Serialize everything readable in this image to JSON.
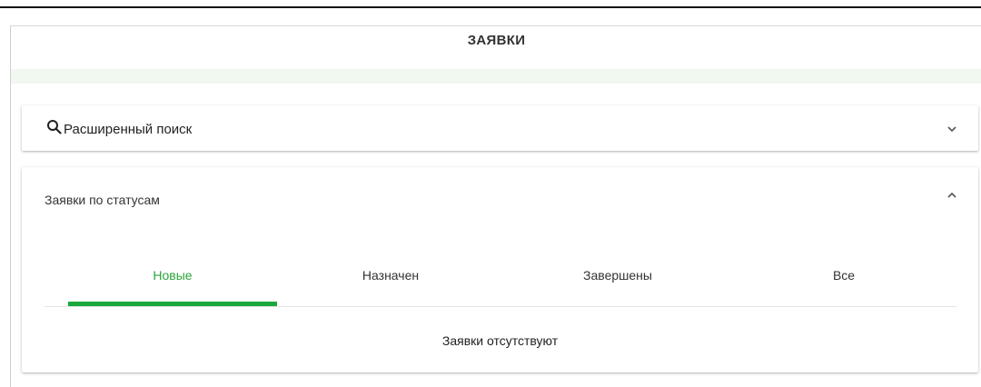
{
  "page": {
    "title": "ЗАЯВКИ"
  },
  "search": {
    "label": "Расширенный поиск"
  },
  "status_panel": {
    "title": "Заявки по статусам",
    "tabs": [
      {
        "label": "Новые",
        "active": true
      },
      {
        "label": "Назначен",
        "active": false
      },
      {
        "label": "Завершены",
        "active": false
      },
      {
        "label": "Все",
        "active": false
      }
    ],
    "empty_message": "Заявки отсутствуют"
  },
  "colors": {
    "accent": "#1aa83b",
    "active_tab_text": "#2aa63c",
    "band": "#f1f8ef"
  },
  "icons": {
    "search": "search-icon",
    "expand": "chevron-down-icon",
    "collapse": "chevron-up-icon"
  }
}
